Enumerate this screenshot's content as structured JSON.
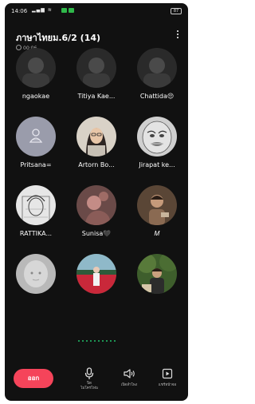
{
  "status": {
    "time": "14:06",
    "battery": "87"
  },
  "header": {
    "title": "ภาษาไทยม.6/2 (14)",
    "duration": "00:06"
  },
  "participants": [
    {
      "name": "ngaokae",
      "avatar_style": "dark-photo"
    },
    {
      "name": "Titiya Kae...",
      "avatar_style": "dark-photo"
    },
    {
      "name": "Chattida😔",
      "avatar_style": "dark-photo"
    },
    {
      "name": "Pritsana=",
      "avatar_style": "default-gray"
    },
    {
      "name": "Artorn Bo...",
      "avatar_style": "girl-photo"
    },
    {
      "name": "Jirapat ke...",
      "avatar_style": "meme-face"
    },
    {
      "name": "RATTIKA...",
      "avatar_style": "sketch"
    },
    {
      "name": "Sunisa🖤",
      "avatar_style": "pink-photo"
    },
    {
      "name": "𝑀",
      "avatar_style": "brown-photo"
    },
    {
      "name": "",
      "avatar_style": "pale-photo"
    },
    {
      "name": "",
      "avatar_style": "flower-field"
    },
    {
      "name": "",
      "avatar_style": "green-outdoor"
    }
  ],
  "pager": {
    "dots": 10,
    "active_color": "#22c06a"
  },
  "controls": {
    "leave_label": "ออก",
    "mic_label": "ปิด\nไมโครโฟน",
    "speaker_label": "เปิดลำโพง",
    "share_label": "แชร์หน้าจอ"
  },
  "colors": {
    "background": "#111111",
    "leave": "#f5445a",
    "accent": "#22c06a"
  }
}
